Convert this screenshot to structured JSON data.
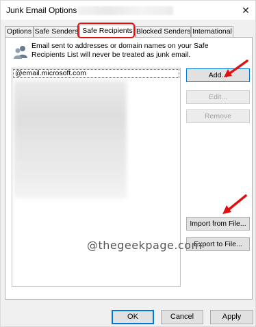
{
  "window": {
    "title": "Junk Email Options -",
    "close_glyph": "✕"
  },
  "tabs": [
    {
      "label": "Options"
    },
    {
      "label": "Safe Senders"
    },
    {
      "label": "Safe Recipients"
    },
    {
      "label": "Blocked Senders"
    },
    {
      "label": "International"
    }
  ],
  "active_tab": "Safe Recipients",
  "info": {
    "text": "Email sent to addresses or domain names on your Safe Recipients List will never be treated as junk email.",
    "icon": "users-icon"
  },
  "list": {
    "items": [
      "@email.microsoft.com"
    ]
  },
  "buttons": {
    "add": "Add...",
    "edit": "Edit...",
    "remove": "Remove",
    "import": "Import from File...",
    "export": "Export to File..."
  },
  "watermark": "@thegeekpage.com",
  "footer": {
    "ok": "OK",
    "cancel": "Cancel",
    "apply": "Apply"
  },
  "colors": {
    "highlight": "#e01010",
    "default_border": "#0078d7"
  }
}
